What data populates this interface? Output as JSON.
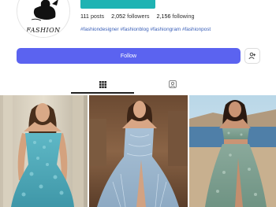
{
  "profile": {
    "logo_text": "FASHION",
    "stats": {
      "posts_count": "111",
      "posts_label": "posts",
      "followers_count": "2,052",
      "followers_label": "followers",
      "following_count": "2,156",
      "following_label": "following"
    },
    "bio_hashtags": "#fashiondesigner #fashionblog #fashiongram #fashionpost"
  },
  "actions": {
    "follow_label": "Follow",
    "add_user_icon": "person-add-icon"
  },
  "tabs": [
    {
      "icon": "grid-icon",
      "active": true
    },
    {
      "icon": "tagged-user-icon",
      "active": false
    }
  ],
  "colors": {
    "accent": "#5b63f0",
    "banner": "#1fb3b3",
    "hashtag": "#3a5fb8"
  },
  "posts": [
    {
      "subject": "woman-in-turquoise-feathered-gown"
    },
    {
      "subject": "woman-in-pale-blue-beaded-gown"
    },
    {
      "subject": "woman-in-sage-sequin-two-piece-gown"
    }
  ]
}
